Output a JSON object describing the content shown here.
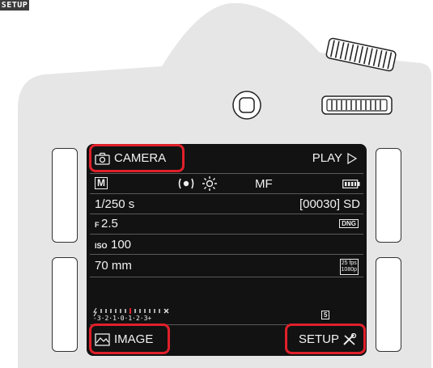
{
  "corner_tag": "SETUP",
  "menu": {
    "camera_label": "CAMERA",
    "play_label": "PLAY",
    "image_label": "IMAGE",
    "setup_label": "SETUP"
  },
  "status": {
    "mode": "M",
    "focus": "MF",
    "shutter": "1/250 s",
    "shots_remaining": "[00030] SD",
    "aperture_prefix": "F",
    "aperture": "2.5",
    "file_format": "DNG",
    "iso_prefix": "ISO",
    "iso": "100",
    "focal_length": "70 mm",
    "video_fps": "25 fps",
    "video_res": "1080p",
    "exposure_scale": "-3·2·1·0·1·2·3+",
    "drive_mode": "5"
  },
  "colors": {
    "highlight": "#e0202a",
    "screen_bg": "#121212",
    "body_fill": "#e6e6e6"
  },
  "icons": {
    "camera": "camera-icon",
    "play": "play-triangle-icon",
    "image": "image-icon",
    "setup": "tools-icon",
    "metering": "spot-metering-icon",
    "white_balance": "sun-icon",
    "battery": "battery-icon",
    "flash": "flash-icon",
    "mode_dial": "mode-dial-icon",
    "thumbwheel": "thumbwheel-icon",
    "joystick": "joystick-icon"
  }
}
